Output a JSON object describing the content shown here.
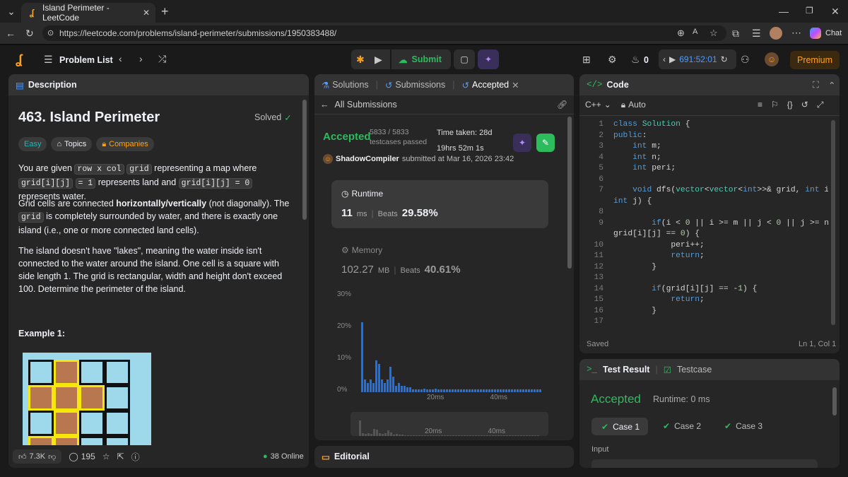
{
  "browser": {
    "tab_title": "Island Perimeter - LeetCode",
    "url": "https://leetcode.com/problems/island-perimeter/submissions/1950383488/",
    "chat_label": "Chat"
  },
  "nav": {
    "problem_list": "Problem List",
    "submit": "Submit",
    "streak": "0",
    "timer": "691:52:01",
    "premium": "Premium"
  },
  "description": {
    "tab": "Description",
    "title": "463. Island Perimeter",
    "status": "Solved",
    "difficulty": "Easy",
    "topics": "Topics",
    "companies": "Companies",
    "p1": [
      "You are given ",
      "row x col",
      " ",
      "grid",
      " representing a map where ",
      "grid[i][j]",
      " ",
      "= 1",
      " represents land and ",
      "grid[i][j] = 0",
      " represents water."
    ],
    "p2": [
      "Grid cells are connected ",
      "horizontally/vertically",
      " (not diagonally). The ",
      "grid",
      " is completely surrounded by water, and there is exactly one island (i.e., one or more connected land cells)."
    ],
    "p3": "The island doesn't have \"lakes\", meaning the water inside isn't connected to the water around the island. One cell is a square with side length 1. The grid is rectangular, width and height don't exceed 100. Determine the perimeter of the island.",
    "example_heading": "Example 1:",
    "likes": "7.3K",
    "comments": "195",
    "online": "38 Online",
    "example_grid": [
      [
        0,
        1,
        0,
        0
      ],
      [
        1,
        1,
        1,
        0
      ],
      [
        0,
        1,
        0,
        0
      ],
      [
        1,
        1,
        0,
        0
      ]
    ],
    "colors": {
      "land": "#b8774f",
      "water": "#9dd9ea",
      "border": "#f5e70a"
    }
  },
  "submission": {
    "tabs": [
      "Solutions",
      "Submissions",
      "Accepted"
    ],
    "back": "All Submissions",
    "verdict": "Accepted",
    "passed": "5833 / 5833",
    "passed_label": "testcases passed",
    "time_taken_label": "Time taken: 28d",
    "time_taken_sub": "19hrs 52m 1s",
    "user": "ShadowCompiler",
    "submitted": "submitted at Mar 16, 2026 23:42",
    "runtime_label": "Runtime",
    "runtime_value": "11",
    "runtime_unit": "ms",
    "runtime_beats_label": "Beats",
    "runtime_beats": "29.58%",
    "memory_label": "Memory",
    "memory_value": "102.27",
    "memory_unit": "MB",
    "memory_beats_label": "Beats",
    "memory_beats": "40.61%",
    "editorial": "Editorial"
  },
  "chart_data": {
    "type": "bar",
    "title": "",
    "xlabel": "",
    "ylabel": "",
    "ylim": [
      0,
      30
    ],
    "y_ticks": [
      "30%",
      "20%",
      "10%",
      "0%"
    ],
    "x_ticks": [
      "20ms",
      "40ms"
    ],
    "series": [
      {
        "values": [
          22,
          4,
          3,
          4,
          3,
          10,
          9,
          4,
          3,
          4,
          8,
          5,
          2,
          3,
          2,
          2,
          1.5,
          1.5,
          1,
          1,
          1,
          1,
          1.2,
          1,
          1,
          1,
          1.2,
          1,
          1,
          1,
          1,
          1,
          1,
          1,
          1,
          1,
          1,
          1,
          1,
          1,
          1,
          1,
          1,
          1,
          1,
          1,
          1,
          1,
          1,
          1,
          1,
          1,
          1,
          1,
          1,
          1,
          1,
          1,
          1,
          1,
          1,
          1,
          1,
          1
        ]
      }
    ],
    "colors": {
      "bar": "#1e72e8",
      "thumb": "#555555"
    }
  },
  "code": {
    "tab": "Code",
    "language": "C++",
    "mode": "Auto",
    "saved": "Saved",
    "cursor": "Ln 1, Col 1",
    "lines": [
      {
        "n": "1",
        "t": "class Solution {"
      },
      {
        "n": "2",
        "t": "public:"
      },
      {
        "n": "3",
        "t": "    int m;"
      },
      {
        "n": "4",
        "t": "    int n;"
      },
      {
        "n": "5",
        "t": "    int peri;"
      },
      {
        "n": "6",
        "t": ""
      },
      {
        "n": "7",
        "t": "    void dfs(vector<vector<int>>& grid, int i,"
      },
      {
        "n": "",
        "t": "int j) {"
      },
      {
        "n": "8",
        "t": ""
      },
      {
        "n": "9",
        "t": "        if(i < 0 || i >= m || j < 0 || j >= n ||"
      },
      {
        "n": "",
        "t": "grid[i][j] == 0) {"
      },
      {
        "n": "10",
        "t": "            peri++;"
      },
      {
        "n": "11",
        "t": "            return;"
      },
      {
        "n": "12",
        "t": "        }"
      },
      {
        "n": "13",
        "t": ""
      },
      {
        "n": "14",
        "t": "        if(grid[i][j] == -1) {"
      },
      {
        "n": "15",
        "t": "            return;"
      },
      {
        "n": "16",
        "t": "        }"
      },
      {
        "n": "17",
        "t": ""
      }
    ]
  },
  "testresult": {
    "tab": "Test Result",
    "tab2": "Testcase",
    "verdict": "Accepted",
    "runtime": "Runtime: 0 ms",
    "cases": [
      "Case 1",
      "Case 2",
      "Case 3"
    ],
    "input_label": "Input"
  }
}
